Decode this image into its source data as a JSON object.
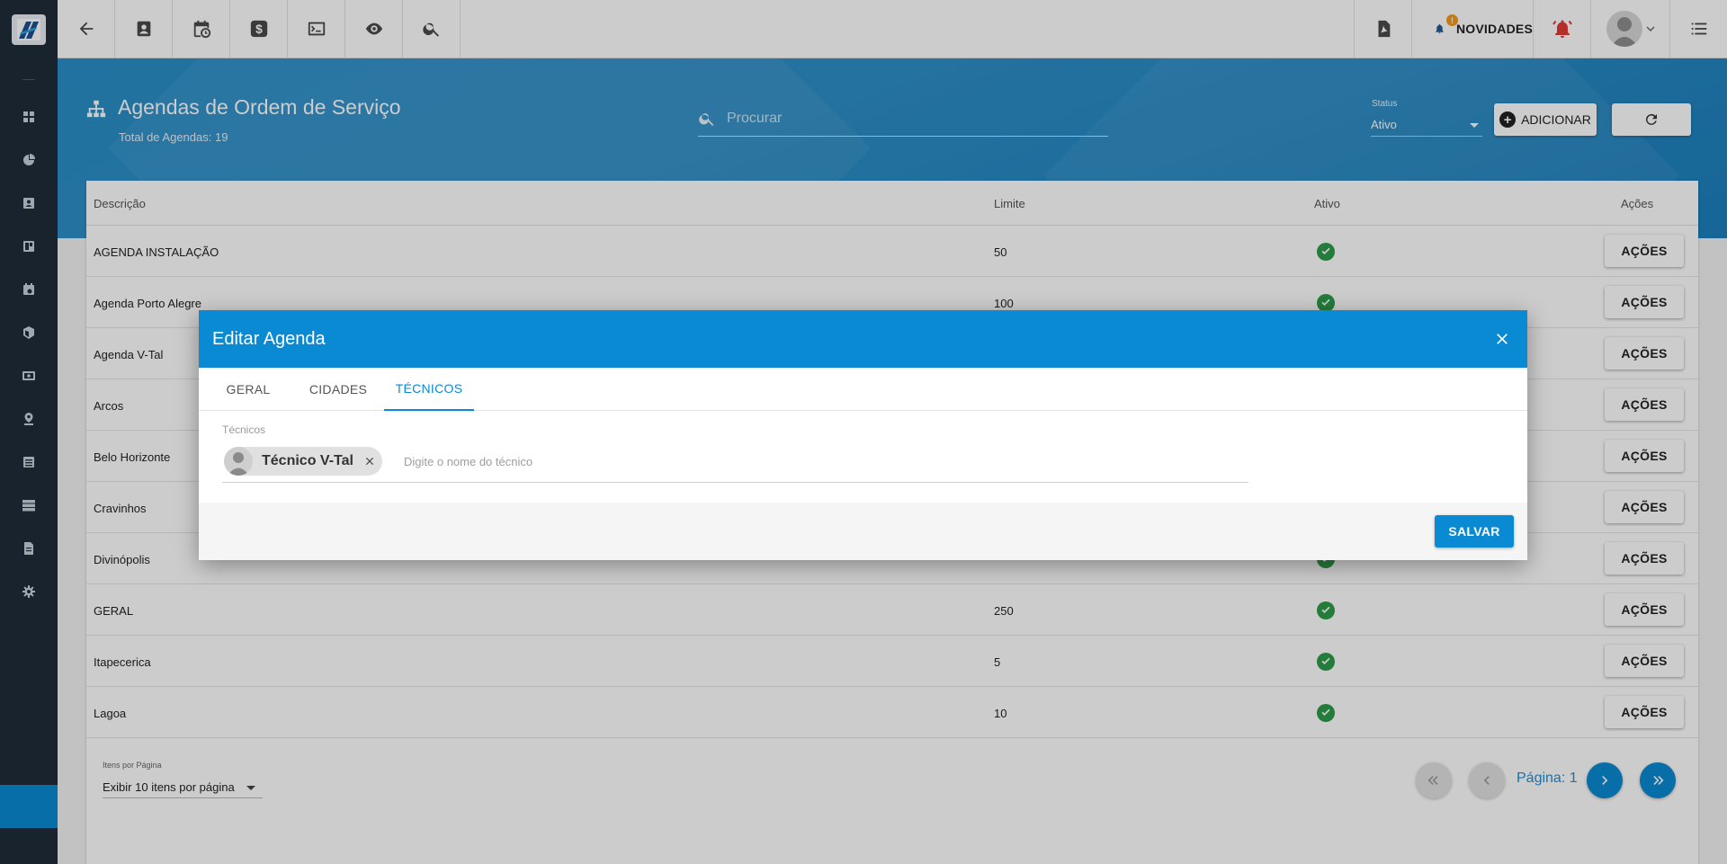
{
  "topbar": {
    "novidades_label": "NOVIDADES",
    "novidades_badge": "!"
  },
  "header": {
    "title": "Agendas de Ordem de Serviço",
    "subtitle": "Total de Agendas: 19",
    "search_placeholder": "Procurar",
    "status_label": "Status",
    "status_value": "Ativo",
    "add_label": "ADICIONAR"
  },
  "table": {
    "columns": [
      "Descrição",
      "Limite",
      "Ativo",
      "Ações"
    ],
    "action_label": "AÇÕES",
    "rows": [
      {
        "descricao": "AGENDA INSTALAÇÃO",
        "limite": "50",
        "ativo": true
      },
      {
        "descricao": "Agenda Porto Alegre",
        "limite": "100",
        "ativo": true
      },
      {
        "descricao": "Agenda V-Tal",
        "limite": "",
        "ativo": true
      },
      {
        "descricao": "Arcos",
        "limite": "",
        "ativo": true
      },
      {
        "descricao": "Belo Horizonte",
        "limite": "",
        "ativo": true
      },
      {
        "descricao": "Cravinhos",
        "limite": "",
        "ativo": true
      },
      {
        "descricao": "Divinópolis",
        "limite": "",
        "ativo": true
      },
      {
        "descricao": "GERAL",
        "limite": "250",
        "ativo": true
      },
      {
        "descricao": "Itapecerica",
        "limite": "5",
        "ativo": true
      },
      {
        "descricao": "Lagoa",
        "limite": "10",
        "ativo": true
      }
    ]
  },
  "pagination": {
    "per_page_label": "Itens por Página",
    "per_page_value": "Exibir 10 itens por página",
    "page_label": "Página: 1"
  },
  "modal": {
    "title": "Editar Agenda",
    "tabs": [
      "GERAL",
      "CIDADES",
      "TÉCNICOS"
    ],
    "active_tab": "TÉCNICOS",
    "field_label": "Técnicos",
    "chip_name": "Técnico V-Tal",
    "input_placeholder": "Digite o nome do técnico",
    "save_label": "SALVAR"
  },
  "colors": {
    "primary": "#0a8ad3",
    "sidebar": "#1f2c3a",
    "success": "#2e9c49",
    "badge": "#f39a1c",
    "alert": "#e53935"
  },
  "icons": {
    "topbar": [
      "back-arrow-icon",
      "contact-card-icon",
      "calendar-clock-icon",
      "dollar-icon",
      "terminal-icon",
      "eye-icon",
      "search-icon"
    ],
    "topbar_right": [
      "pdf-icon",
      "bell-icon",
      "alarm-bell-icon",
      "avatar",
      "list-icon"
    ],
    "sidebar": [
      "dashboard-icon",
      "pie-chart-icon",
      "contact-icon",
      "board-icon",
      "calendar-icon",
      "box-icon",
      "money-icon",
      "map-pin-icon",
      "list-icon",
      "server-icon",
      "document-icon",
      "settings-icon"
    ]
  }
}
